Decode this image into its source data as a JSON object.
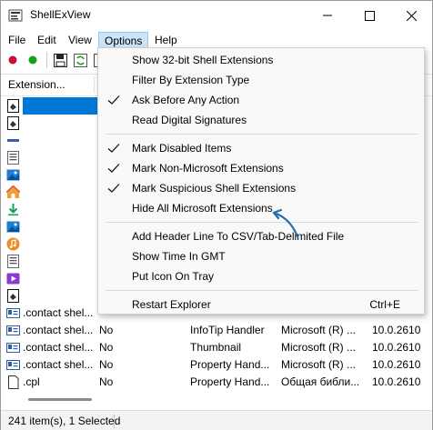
{
  "window": {
    "title": "ShellExView"
  },
  "menubar": {
    "items": [
      "File",
      "Edit",
      "View",
      "Options",
      "Help"
    ],
    "active_index": 3
  },
  "listview": {
    "columns": [
      "Extension..."
    ],
    "rows": [
      {
        "icon": "doc-generic-icon",
        "cells": [
          "",
          "",
          "",
          "",
          ""
        ]
      },
      {
        "icon": "doc-generic-icon",
        "cells": [
          "",
          "",
          "",
          "",
          ""
        ]
      },
      {
        "icon": "dash-icon",
        "cells": [
          "",
          "",
          "",
          "",
          ""
        ]
      },
      {
        "icon": "list-doc-icon",
        "cells": [
          "",
          "",
          "",
          "",
          ""
        ]
      },
      {
        "icon": "picture-icon",
        "cells": [
          "",
          "",
          "",
          "",
          ""
        ]
      },
      {
        "icon": "home-icon",
        "cells": [
          "",
          "",
          "",
          "",
          ""
        ]
      },
      {
        "icon": "download-icon",
        "cells": [
          "",
          "",
          "",
          "",
          ""
        ]
      },
      {
        "icon": "picture-icon",
        "cells": [
          "",
          "",
          "",
          "",
          ""
        ]
      },
      {
        "icon": "music-icon",
        "cells": [
          "",
          "",
          "",
          "",
          ""
        ]
      },
      {
        "icon": "list-doc-icon",
        "cells": [
          "",
          "",
          "",
          "",
          ""
        ]
      },
      {
        "icon": "video-icon",
        "cells": [
          "",
          "",
          "",
          "",
          ""
        ]
      },
      {
        "icon": "doc-generic-icon",
        "cells": [
          "",
          "",
          "",
          "",
          ""
        ]
      },
      {
        "icon": "contact-icon",
        "cells": [
          ".contact shel...",
          "",
          "",
          "",
          ""
        ]
      },
      {
        "icon": "contact-icon",
        "cells": [
          ".contact shel...",
          "No",
          "InfoTip Handler",
          "Microsoft (R) ...",
          "10.0.2610"
        ]
      },
      {
        "icon": "contact-icon",
        "cells": [
          ".contact shel...",
          "No",
          "Thumbnail",
          "Microsoft (R) ...",
          "10.0.2610"
        ]
      },
      {
        "icon": "contact-icon",
        "cells": [
          ".contact shel...",
          "No",
          "Property Hand...",
          "Microsoft (R) ...",
          "10.0.2610"
        ]
      },
      {
        "icon": "blank-file-icon",
        "cells": [
          ".cpl",
          "No",
          "Property Hand...",
          "Общая библи...",
          "10.0.2610"
        ]
      }
    ]
  },
  "options_menu": {
    "groups": [
      [
        {
          "label": "Show 32-bit Shell Extensions",
          "checked": false
        },
        {
          "label": "Filter By Extension Type",
          "checked": false
        },
        {
          "label": "Ask Before Any Action",
          "checked": true
        },
        {
          "label": "Read Digital Signatures",
          "checked": false
        }
      ],
      [
        {
          "label": "Mark Disabled Items",
          "checked": true
        },
        {
          "label": "Mark Non-Microsoft Extensions",
          "checked": true
        },
        {
          "label": "Mark Suspicious Shell Extensions",
          "checked": true
        },
        {
          "label": "Hide All Microsoft Extensions",
          "checked": false
        }
      ],
      [
        {
          "label": "Add Header Line To CSV/Tab-Delimited File",
          "checked": false
        },
        {
          "label": "Show Time In GMT",
          "checked": false
        },
        {
          "label": "Put Icon On Tray",
          "checked": false
        }
      ],
      [
        {
          "label": "Restart Explorer",
          "checked": false,
          "shortcut": "Ctrl+E"
        }
      ]
    ]
  },
  "status": {
    "text": "241 item(s), 1 Selected"
  },
  "colors": {
    "selection": "#0078d7",
    "annotation_arrow": "#1f6fb2",
    "menu_hover": "#cce4f7"
  }
}
